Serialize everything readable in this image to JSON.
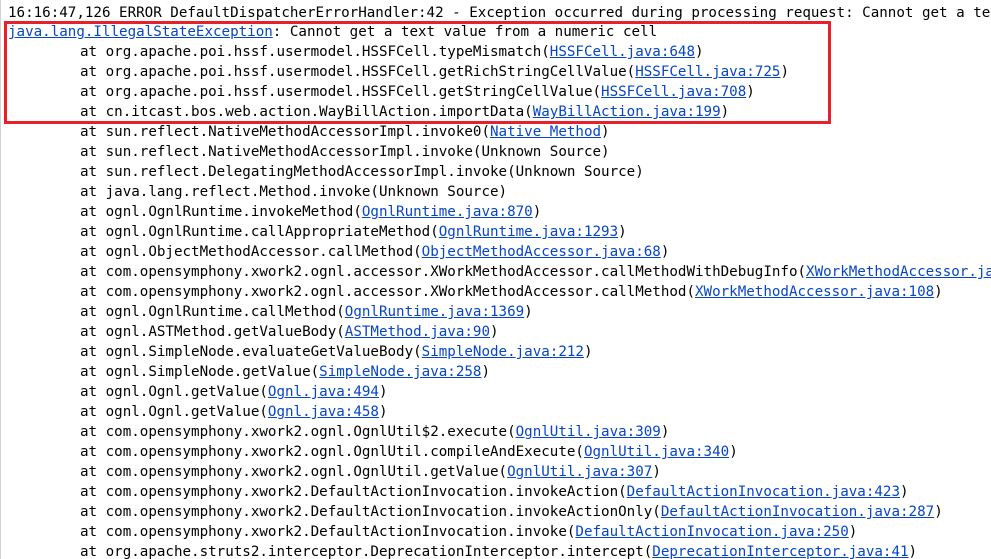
{
  "console": {
    "header": "16:16:47,126 ERROR DefaultDispatcherErrorHandler:42 - Exception occurred during processing request: Cannot get a text value from a numeric cell",
    "exception": {
      "class": "java.lang.IllegalStateException",
      "message": ": Cannot get a text value from a numeric cell"
    },
    "highlight_color": "#e8202a",
    "link_color": "#0645c8",
    "frames": [
      {
        "at": "at ",
        "method": "org.apache.poi.hssf.usermodel.HSSFCell.typeMismatch(",
        "link": "HSSFCell.java:648",
        "close": ")"
      },
      {
        "at": "at ",
        "method": "org.apache.poi.hssf.usermodel.HSSFCell.getRichStringCellValue(",
        "link": "HSSFCell.java:725",
        "close": ")"
      },
      {
        "at": "at ",
        "method": "org.apache.poi.hssf.usermodel.HSSFCell.getStringCellValue(",
        "link": "HSSFCell.java:708",
        "close": ")"
      },
      {
        "at": "at ",
        "method": "cn.itcast.bos.web.action.WayBillAction.importData(",
        "link": "WayBillAction.java:199",
        "close": ")"
      },
      {
        "at": "at ",
        "method": "sun.reflect.NativeMethodAccessorImpl.invoke0(",
        "link": "Native Method",
        "close": ")"
      },
      {
        "at": "at ",
        "method": "sun.reflect.NativeMethodAccessorImpl.invoke(Unknown Source)",
        "link": "",
        "close": ""
      },
      {
        "at": "at ",
        "method": "sun.reflect.DelegatingMethodAccessorImpl.invoke(Unknown Source)",
        "link": "",
        "close": ""
      },
      {
        "at": "at ",
        "method": "java.lang.reflect.Method.invoke(Unknown Source)",
        "link": "",
        "close": ""
      },
      {
        "at": "at ",
        "method": "ognl.OgnlRuntime.invokeMethod(",
        "link": "OgnlRuntime.java:870",
        "close": ")"
      },
      {
        "at": "at ",
        "method": "ognl.OgnlRuntime.callAppropriateMethod(",
        "link": "OgnlRuntime.java:1293",
        "close": ")"
      },
      {
        "at": "at ",
        "method": "ognl.ObjectMethodAccessor.callMethod(",
        "link": "ObjectMethodAccessor.java:68",
        "close": ")"
      },
      {
        "at": "at ",
        "method": "com.opensymphony.xwork2.ognl.accessor.XWorkMethodAccessor.callMethodWithDebugInfo(",
        "link": "XWorkMethodAccessor.java:",
        "close": ""
      },
      {
        "at": "at ",
        "method": "com.opensymphony.xwork2.ognl.accessor.XWorkMethodAccessor.callMethod(",
        "link": "XWorkMethodAccessor.java:108",
        "close": ")"
      },
      {
        "at": "at ",
        "method": "ognl.OgnlRuntime.callMethod(",
        "link": "OgnlRuntime.java:1369",
        "close": ")"
      },
      {
        "at": "at ",
        "method": "ognl.ASTMethod.getValueBody(",
        "link": "ASTMethod.java:90",
        "close": ")"
      },
      {
        "at": "at ",
        "method": "ognl.SimpleNode.evaluateGetValueBody(",
        "link": "SimpleNode.java:212",
        "close": ")"
      },
      {
        "at": "at ",
        "method": "ognl.SimpleNode.getValue(",
        "link": "SimpleNode.java:258",
        "close": ")"
      },
      {
        "at": "at ",
        "method": "ognl.Ognl.getValue(",
        "link": "Ognl.java:494",
        "close": ")"
      },
      {
        "at": "at ",
        "method": "ognl.Ognl.getValue(",
        "link": "Ognl.java:458",
        "close": ")"
      },
      {
        "at": "at ",
        "method": "com.opensymphony.xwork2.ognl.OgnlUtil$2.execute(",
        "link": "OgnlUtil.java:309",
        "close": ")"
      },
      {
        "at": "at ",
        "method": "com.opensymphony.xwork2.ognl.OgnlUtil.compileAndExecute(",
        "link": "OgnlUtil.java:340",
        "close": ")"
      },
      {
        "at": "at ",
        "method": "com.opensymphony.xwork2.ognl.OgnlUtil.getValue(",
        "link": "OgnlUtil.java:307",
        "close": ")"
      },
      {
        "at": "at ",
        "method": "com.opensymphony.xwork2.DefaultActionInvocation.invokeAction(",
        "link": "DefaultActionInvocation.java:423",
        "close": ")"
      },
      {
        "at": "at ",
        "method": "com.opensymphony.xwork2.DefaultActionInvocation.invokeActionOnly(",
        "link": "DefaultActionInvocation.java:287",
        "close": ")"
      },
      {
        "at": "at ",
        "method": "com.opensymphony.xwork2.DefaultActionInvocation.invoke(",
        "link": "DefaultActionInvocation.java:250",
        "close": ")"
      },
      {
        "at": "at ",
        "method": "org.apache.struts2.interceptor.DeprecationInterceptor.intercept(",
        "link": "DeprecationInterceptor.java:41",
        "close": ")"
      }
    ]
  }
}
